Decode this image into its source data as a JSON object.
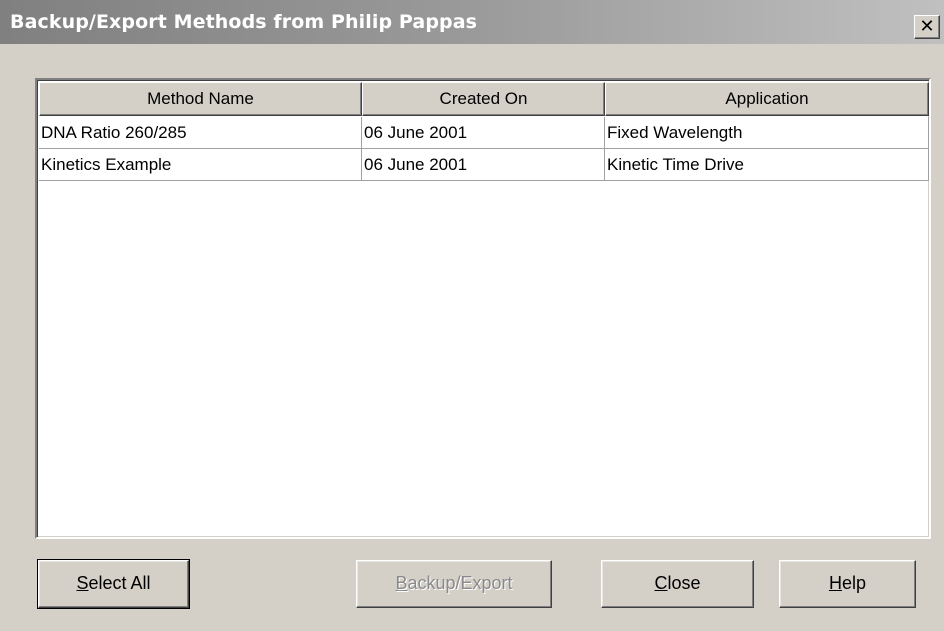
{
  "window": {
    "title": "Backup/Export Methods from Philip Pappas",
    "close_glyph": "✕"
  },
  "table": {
    "columns": [
      "Method Name",
      "Created On",
      "Application"
    ],
    "rows": [
      [
        "DNA Ratio 260/285",
        "06 June 2001",
        "Fixed Wavelength"
      ],
      [
        "Kinetics Example",
        "06 June 2001",
        "Kinetic Time Drive"
      ]
    ]
  },
  "buttons": {
    "select_all": {
      "mnemonic": "S",
      "rest": "elect All"
    },
    "backup_export": {
      "mnemonic": "B",
      "rest": "ackup/Export",
      "enabled": false
    },
    "close": {
      "mnemonic": "C",
      "rest": "lose"
    },
    "help": {
      "mnemonic": "H",
      "rest": "elp"
    }
  }
}
